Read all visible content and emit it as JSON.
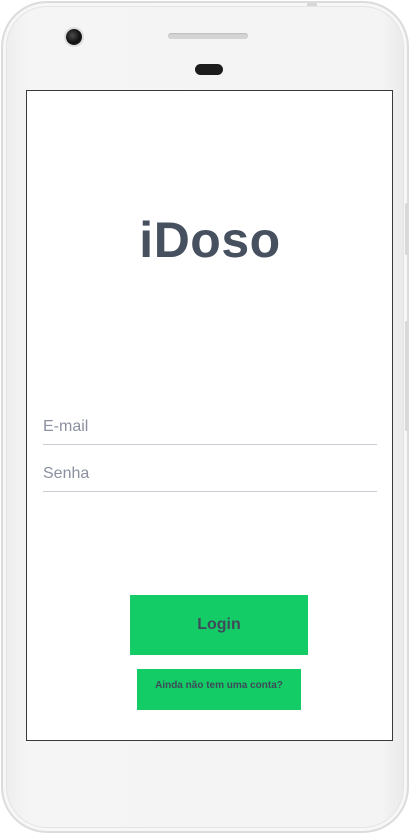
{
  "app": {
    "title": "iDoso"
  },
  "login_form": {
    "email_placeholder": "E-mail",
    "password_placeholder": "Senha",
    "login_label": "Login",
    "signup_label": "Ainda não tem uma conta?"
  },
  "colors": {
    "accent": "#13cc66",
    "title_text": "#46505f",
    "button_text": "#3f4a5a"
  }
}
